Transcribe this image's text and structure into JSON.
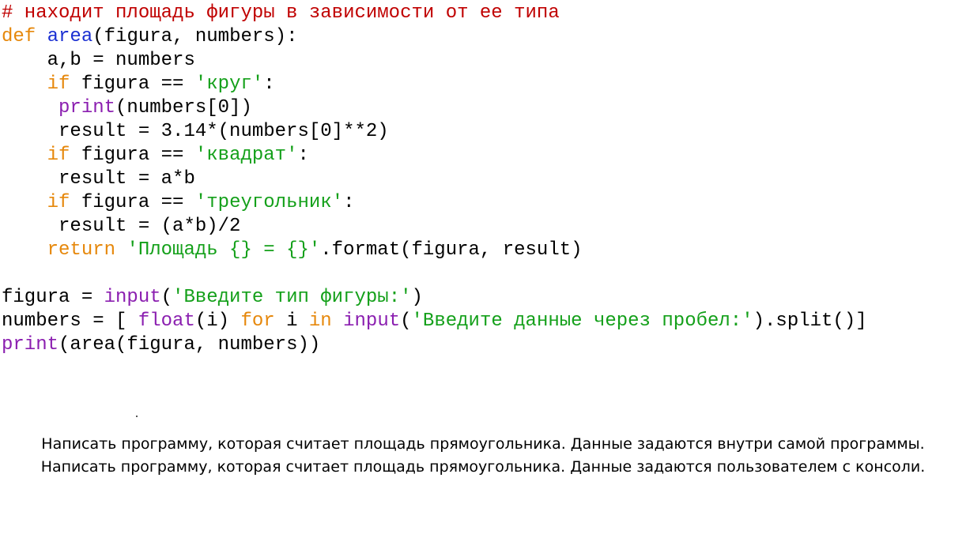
{
  "colors": {
    "comment": "#c00000",
    "keyword": "#e6880c",
    "function": "#1a2fd2",
    "builtin": "#8b1fb0",
    "string": "#14a01a",
    "text": "#000000"
  },
  "code_lines": [
    [
      [
        "comment",
        "# находит площадь фигуры в зависимости от ее типа"
      ]
    ],
    [
      [
        "keyword",
        "def"
      ],
      [
        "plain",
        " "
      ],
      [
        "func",
        "area"
      ],
      [
        "plain",
        "(figura, numbers):"
      ]
    ],
    [
      [
        "plain",
        "    a,b = numbers"
      ]
    ],
    [
      [
        "plain",
        "    "
      ],
      [
        "keyword",
        "if"
      ],
      [
        "plain",
        " figura == "
      ],
      [
        "string",
        "'круг'"
      ],
      [
        "plain",
        ":"
      ]
    ],
    [
      [
        "plain",
        "     "
      ],
      [
        "builtin",
        "print"
      ],
      [
        "plain",
        "(numbers[0])"
      ]
    ],
    [
      [
        "plain",
        "     result = 3.14*(numbers[0]**2)"
      ]
    ],
    [
      [
        "plain",
        "    "
      ],
      [
        "keyword",
        "if"
      ],
      [
        "plain",
        " figura == "
      ],
      [
        "string",
        "'квадрат'"
      ],
      [
        "plain",
        ":"
      ]
    ],
    [
      [
        "plain",
        "     result = a*b"
      ]
    ],
    [
      [
        "plain",
        "    "
      ],
      [
        "keyword",
        "if"
      ],
      [
        "plain",
        " figura == "
      ],
      [
        "string",
        "'треугольник'"
      ],
      [
        "plain",
        ":"
      ]
    ],
    [
      [
        "plain",
        "     result = (a*b)/2"
      ]
    ],
    [
      [
        "plain",
        "    "
      ],
      [
        "keyword",
        "return"
      ],
      [
        "plain",
        " "
      ],
      [
        "string",
        "'Площадь {} = {}'"
      ],
      [
        "plain",
        ".format(figura, result)"
      ]
    ],
    [
      [
        "plain",
        ""
      ]
    ],
    [
      [
        "plain",
        "figura = "
      ],
      [
        "builtin",
        "input"
      ],
      [
        "plain",
        "("
      ],
      [
        "string",
        "'Введите тип фигуры:'"
      ],
      [
        "plain",
        ")"
      ]
    ],
    [
      [
        "plain",
        "numbers = [ "
      ],
      [
        "builtin",
        "float"
      ],
      [
        "plain",
        "(i) "
      ],
      [
        "keyword",
        "for"
      ],
      [
        "plain",
        " i "
      ],
      [
        "keyword",
        "in"
      ],
      [
        "plain",
        " "
      ],
      [
        "builtin",
        "input"
      ],
      [
        "plain",
        "("
      ],
      [
        "string",
        "'Введите данные через пробел:'"
      ],
      [
        "plain",
        ").split()]"
      ]
    ],
    [
      [
        "builtin",
        "print"
      ],
      [
        "plain",
        "(area(figura, numbers))"
      ]
    ]
  ],
  "tasks": [
    "Написать программу, которая считает площадь прямоугольника. Данные задаются внутри самой программы.",
    "Написать программу, которая считает площадь прямоугольника. Данные задаются пользователем с консоли."
  ]
}
